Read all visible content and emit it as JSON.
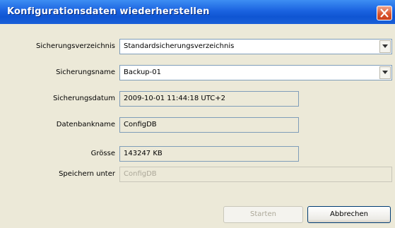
{
  "window": {
    "title": "Konfigurationsdaten wiederherstellen"
  },
  "form": {
    "backup_dir_label": "Sicherungsverzeichnis",
    "backup_dir_value": "Standardsicherungsverzeichnis",
    "backup_name_label": "Sicherungsname",
    "backup_name_value": "Backup-01",
    "backup_date_label": "Sicherungsdatum",
    "backup_date_value": "2009-10-01 11:44:18 UTC+2",
    "db_name_label": "Datenbankname",
    "db_name_value": "ConfigDB",
    "size_label": "Grösse",
    "size_value": "143247 KB",
    "save_as_label": "Speichern unter",
    "save_as_value": "ConfigDB"
  },
  "buttons": {
    "start_label": "Starten",
    "cancel_label": "Abbrechen"
  },
  "icons": {
    "close": "close-icon",
    "dropdown": "chevron-down-icon"
  }
}
